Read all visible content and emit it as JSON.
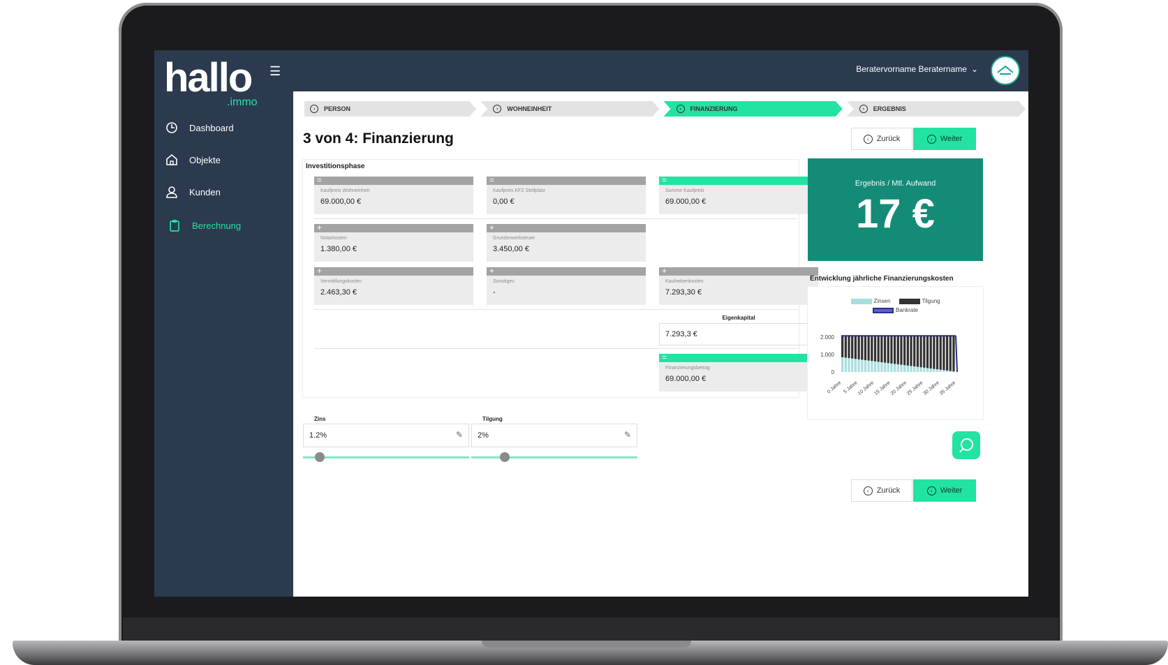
{
  "brand": {
    "logo": "hallo",
    "logo_sub": ".immo"
  },
  "sidebar": {
    "items": [
      {
        "label": "Dashboard",
        "icon": "clock-icon"
      },
      {
        "label": "Objekte",
        "icon": "home-icon"
      },
      {
        "label": "Kunden",
        "icon": "user-icon"
      },
      {
        "label": "Berechnung",
        "icon": "clipboard-icon",
        "active": true
      }
    ]
  },
  "topbar": {
    "user_name": "Beratervorname Beratername"
  },
  "steps": [
    {
      "label": "PERSON"
    },
    {
      "label": "WOHNEINHEIT"
    },
    {
      "label": "FINANZIERUNG",
      "active": true
    },
    {
      "label": "ERGEBNIS"
    }
  ],
  "page": {
    "title": "3 von 4: Finanzierung",
    "back_label": "Zurück",
    "next_label": "Weiter"
  },
  "investment": {
    "section_label": "Investitionsphase",
    "fields": [
      {
        "label": "Kaufpreis Wohneinheit",
        "value": "69.000,00 €",
        "op": "="
      },
      {
        "label": "Kaufpreis KFZ Stellplatz",
        "value": "0,00 €",
        "op": "="
      },
      {
        "label": "Summe Kaufpreis",
        "value": "69.000,00 €",
        "op": "="
      },
      {
        "label": "Notarkosten",
        "value": "1.380,00 €",
        "op": "+"
      },
      {
        "label": "Grunderwerbsteuer",
        "value": "3.450,00 €",
        "op": "+"
      },
      {
        "label": "Vermittlungskosten",
        "value": "2.463,30 €",
        "op": "+"
      },
      {
        "label": "Sonstiges",
        "value": "-",
        "op": "+"
      },
      {
        "label": "Kaufnebenkosten",
        "value": "7.293,30 €",
        "op": "+"
      },
      {
        "label": "Finanzierungsbetrag",
        "value": "69.000,00 €",
        "op": "="
      }
    ],
    "eigenkapital": {
      "label": "Eigenkapital",
      "value": "7.293,3 €"
    }
  },
  "result": {
    "label": "Ergebnis / Mtl. Aufwand",
    "value": "17 €"
  },
  "chart_title": "Entwicklung jährliche Finanzierungskosten",
  "chart_data": {
    "type": "bar",
    "legend": [
      "Zinsen",
      "Tilgung",
      "Bankrate"
    ],
    "y_ticks": [
      "2.000",
      "1.000",
      "0"
    ],
    "x_ticks": [
      "0 Jahre",
      "5 Jahre",
      "10 Jahre",
      "15 Jahre",
      "20 Jahre",
      "25 Jahre",
      "30 Jahre",
      "35 Jahre"
    ],
    "ylim": [
      0,
      2400
    ],
    "colors": {
      "zinsen": "#a8dede",
      "tilgung": "#333333",
      "bankrate": "#2a2f8a"
    },
    "years": 35,
    "bankrate": 2070,
    "zinsen_start": 840,
    "zinsen_end": 30
  },
  "sliders": [
    {
      "label": "Zins",
      "value": "1.2%",
      "level": 0.1
    },
    {
      "label": "Tilgung",
      "value": "2%",
      "level": 0.2
    }
  ]
}
